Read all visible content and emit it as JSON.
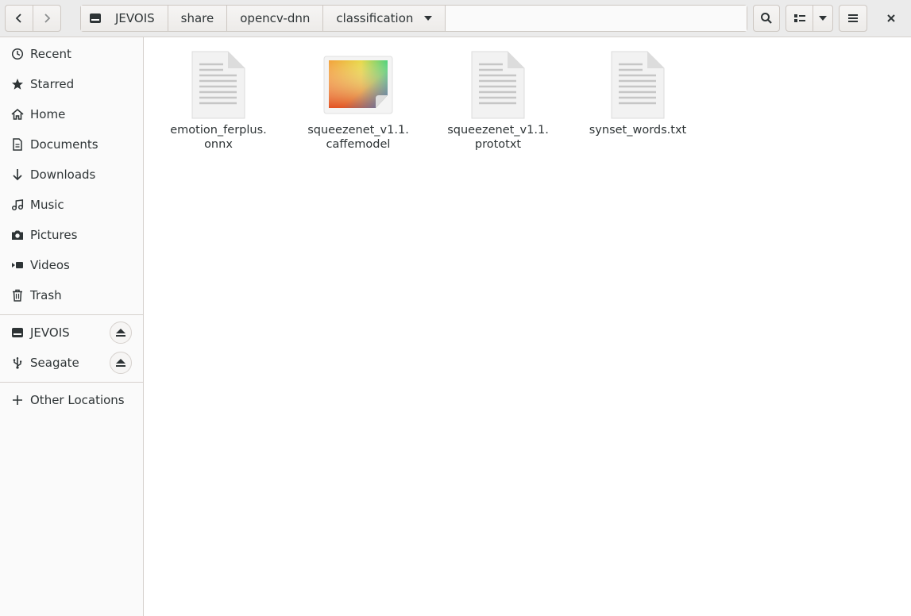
{
  "header": {
    "back_icon": "go-back-icon",
    "forward_icon": "go-forward-icon",
    "breadcrumbs": [
      {
        "label": "JEVOIS",
        "icon": "drive-icon"
      },
      {
        "label": "share"
      },
      {
        "label": "opencv-dnn"
      },
      {
        "label": "classification"
      }
    ],
    "search_icon": "search-icon",
    "view_icon": "list-view-icon",
    "menu_icon": "hamburger-menu-icon",
    "close_icon": "close-icon"
  },
  "sidebar": {
    "places": [
      {
        "label": "Recent",
        "icon": "clock-icon"
      },
      {
        "label": "Starred",
        "icon": "star-icon"
      },
      {
        "label": "Home",
        "icon": "home-icon"
      },
      {
        "label": "Documents",
        "icon": "document-icon"
      },
      {
        "label": "Downloads",
        "icon": "download-icon"
      },
      {
        "label": "Music",
        "icon": "music-icon"
      },
      {
        "label": "Pictures",
        "icon": "camera-icon"
      },
      {
        "label": "Videos",
        "icon": "video-icon"
      },
      {
        "label": "Trash",
        "icon": "trash-icon"
      }
    ],
    "devices": [
      {
        "label": "JEVOIS",
        "icon": "drive-icon",
        "eject": true
      },
      {
        "label": "Seagate",
        "icon": "usb-icon",
        "eject": true
      }
    ],
    "other": {
      "label": "Other Locations",
      "icon": "plus-icon"
    }
  },
  "files": [
    {
      "line1": "emotion_ferplus.",
      "line2": "onnx",
      "type": "text"
    },
    {
      "line1": "squeezenet_v1.1.",
      "line2": "caffemodel",
      "type": "image"
    },
    {
      "line1": "squeezenet_v1.1.",
      "line2": "prototxt",
      "type": "text"
    },
    {
      "line1": "synset_words.txt",
      "line2": "",
      "type": "text"
    }
  ]
}
